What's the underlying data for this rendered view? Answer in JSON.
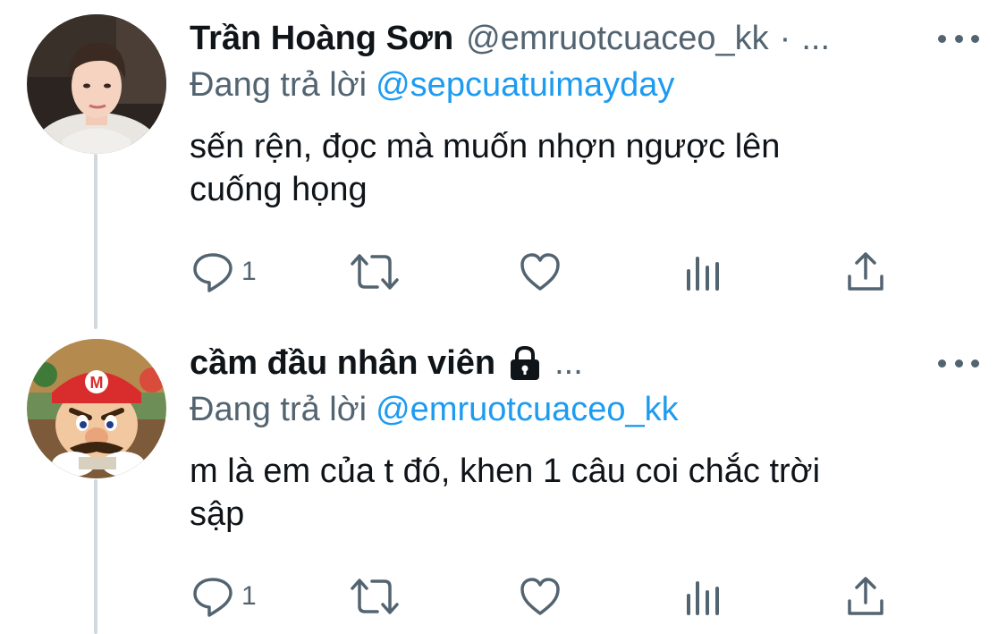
{
  "tweets": [
    {
      "display_name": "Trần Hoàng Sơn",
      "handle": "@emruotcuaceo_kk",
      "separator": "·",
      "truncation": "...",
      "reply_prefix": "Đang trả lời",
      "reply_to": "@sepcuatuimayday",
      "body_line1": "sến rện, đọc mà muốn nhợn ngược lên",
      "body_line2": "cuống họng",
      "reply_count": "1",
      "avatar": "person-portrait",
      "protected": false
    },
    {
      "display_name": "cầm đầu nhân viên",
      "truncation": "...",
      "reply_prefix": "Đang trả lời",
      "reply_to": "@emruotcuaceo_kk",
      "body_line1": "m là em của t đó, khen 1 câu coi chắc trời",
      "body_line2": "sập",
      "reply_count": "1",
      "avatar": "mario-cartoon",
      "protected": true
    }
  ],
  "icons": {
    "reply": "reply-icon",
    "retweet": "retweet-icon",
    "like": "like-icon",
    "analytics": "analytics-icon",
    "share": "share-icon",
    "more": "more-icon",
    "lock": "lock-icon"
  },
  "colors": {
    "text": "#0f1419",
    "secondary": "#536471",
    "accent": "#1d9bf0",
    "thread_line": "#cfd9de"
  }
}
